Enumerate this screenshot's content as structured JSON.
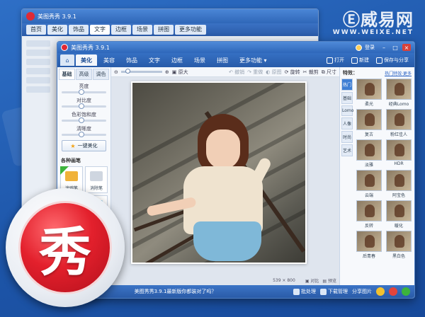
{
  "watermark": {
    "logo": "Ⓔ威易网",
    "url": "WWW.WEIXE.NET"
  },
  "back_window": {
    "title": "美图秀秀 3.9.1",
    "tabs": [
      "首页",
      "美化",
      "饰品",
      "文字",
      "边框",
      "场景",
      "拼图",
      "更多功能"
    ]
  },
  "window": {
    "title": "美图秀秀 3.9.1",
    "login": "登录"
  },
  "menu": {
    "tabs": [
      "美化",
      "美容",
      "饰品",
      "文字",
      "边框",
      "场景",
      "拼图",
      "更多功能"
    ],
    "active_index": 0,
    "actions": [
      "打开",
      "新建",
      "保存与分享"
    ]
  },
  "left": {
    "subtabs": [
      "基础",
      "高级",
      "调色"
    ],
    "sliders": [
      {
        "label": "亮度",
        "level": 0.5
      },
      {
        "label": "对比度",
        "level": 0.5
      },
      {
        "label": "色彩饱和度",
        "level": 0.5
      },
      {
        "label": "清晰度",
        "level": 0.5
      }
    ],
    "one_click": "一键美化",
    "section": "各种画笔",
    "pens": [
      {
        "label": "涂鸦笔",
        "color": "#f0b23a"
      },
      {
        "label": "消除笔",
        "color": "#cfd6e0"
      },
      {
        "label": "",
        "color": "#f3d3c0"
      },
      {
        "label": "",
        "color": "#7fc2e6"
      }
    ]
  },
  "toolbar": {
    "zoom_label": "原大",
    "items": [
      "撤销",
      "重做",
      "原图",
      "旋转",
      "裁剪",
      "尺寸"
    ]
  },
  "status": {
    "size": "539 × 800",
    "chip": "",
    "compare": "对比",
    "preview": "预览"
  },
  "right": {
    "title": "特效：",
    "link": "热门特效·更多",
    "categories": [
      "热门",
      "基础",
      "Lomo",
      "人像",
      "时尚",
      "艺术"
    ],
    "effects": [
      "柔光",
      "经典Lomo",
      "复古",
      "粉红佳人",
      "淡雅",
      "HDR",
      "云端",
      "阿宝色",
      "反转",
      "暖化",
      "后青春",
      "黑白色"
    ]
  },
  "bottom": {
    "tip": "美图秀秀3.9.1最新版你都装对了吗？",
    "buttons": [
      "批处理",
      "下载管理",
      "分享图片"
    ]
  },
  "logo": {
    "char": "秀"
  }
}
